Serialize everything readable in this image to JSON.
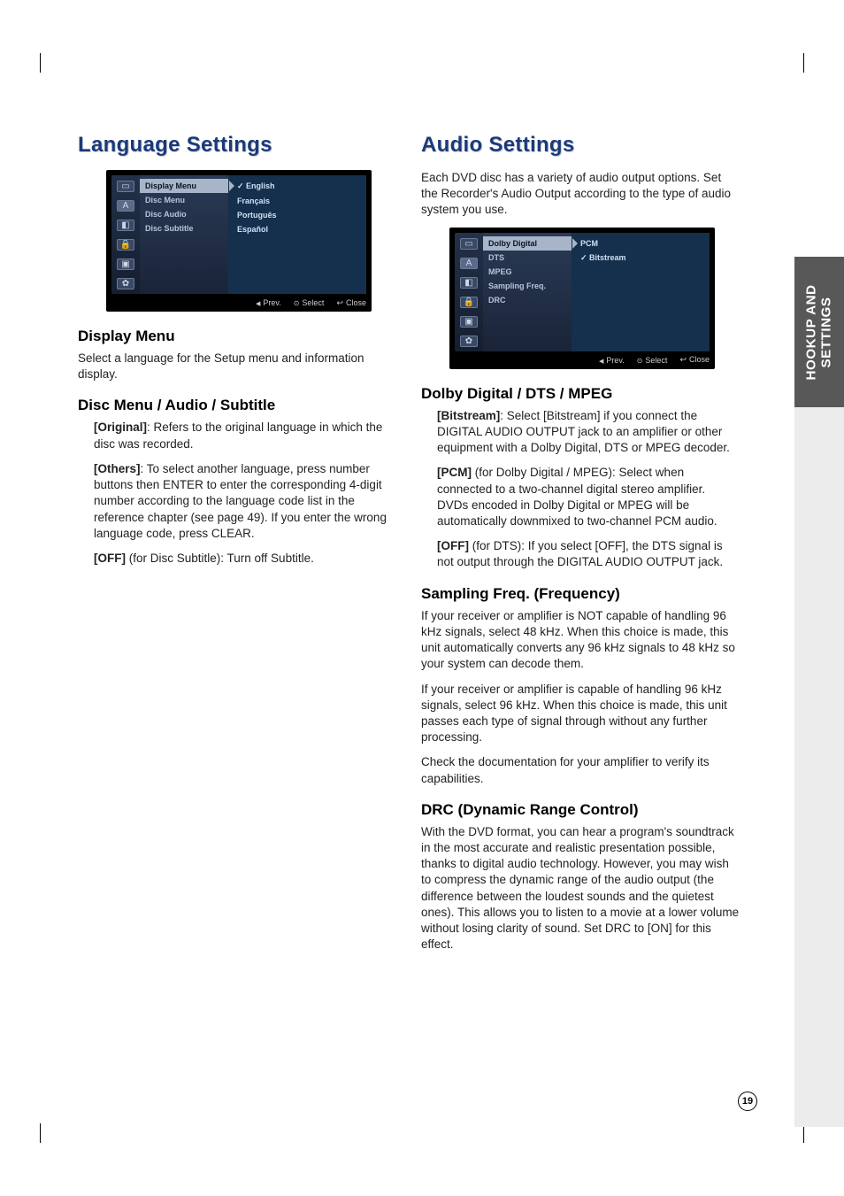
{
  "sidetab": {
    "line1": "HOOKUP AND",
    "line2": "SETTINGS"
  },
  "pagenum": "19",
  "left": {
    "title": "Language Settings",
    "osd": {
      "icons": [
        "▭",
        "A",
        "◧",
        "🔒",
        "▣",
        "✿"
      ],
      "selectedIcon": 1,
      "menu": [
        "Display Menu",
        "Disc Menu",
        "Disc Audio",
        "Disc Subtitle"
      ],
      "selectedMenu": 0,
      "opts": [
        "English",
        "Français",
        "Português",
        "Español"
      ],
      "checkedOpt": 0,
      "footer": {
        "prev": "Prev.",
        "select": "Select",
        "close": "Close"
      }
    },
    "h_display": "Display Menu",
    "p_display": "Select a language for the Setup menu and information display.",
    "h_disc": "Disc Menu / Audio / Subtitle",
    "disc_original_label": "[Original]",
    "disc_original_text": ": Refers to the original language in which the disc was recorded.",
    "disc_others_label": "[Others]",
    "disc_others_text": ": To select another language, press number buttons then ENTER to enter the corresponding 4-digit number according to the language code list in the reference chapter (see page 49). If you enter the wrong language code, press CLEAR.",
    "disc_off_label": "[OFF]",
    "disc_off_text": " (for Disc Subtitle): Turn off Subtitle."
  },
  "right": {
    "title": "Audio Settings",
    "intro": "Each DVD disc has a variety of audio output options. Set the Recorder's Audio Output according to the type of audio system you use.",
    "osd": {
      "icons": [
        "▭",
        "A",
        "◧",
        "🔒",
        "▣",
        "✿"
      ],
      "selectedIcon": 1,
      "menu": [
        "Dolby Digital",
        "DTS",
        "MPEG",
        "Sampling Freq.",
        "DRC"
      ],
      "selectedMenu": 0,
      "opts": [
        "PCM",
        "Bitstream"
      ],
      "checkedOpt": 1,
      "footer": {
        "prev": "Prev.",
        "select": "Select",
        "close": "Close"
      }
    },
    "h_dolby": "Dolby Digital / DTS / MPEG",
    "dolby_bits_label": "[Bitstream]",
    "dolby_bits_text": ": Select [Bitstream] if you connect the DIGITAL AUDIO OUTPUT jack to an amplifier or other equipment with a Dolby Digital, DTS or MPEG decoder.",
    "dolby_pcm_label": "[PCM]",
    "dolby_pcm_text": " (for Dolby Digital / MPEG): Select when connected to a two-channel digital stereo amplifier. DVDs encoded in Dolby Digital or MPEG will be automatically downmixed to two-channel PCM audio.",
    "dolby_off_label": "[OFF]",
    "dolby_off_text": " (for DTS): If you select [OFF], the DTS signal is not output through the DIGITAL AUDIO OUTPUT jack.",
    "h_samp": "Sampling Freq. (Frequency)",
    "samp_p1": "If your receiver or amplifier is NOT capable of handling 96 kHz signals, select 48 kHz. When this choice is made, this unit automatically converts any 96 kHz signals to 48 kHz so your system can decode them.",
    "samp_p2": "If your receiver or amplifier is capable of handling 96 kHz signals, select 96 kHz. When this choice is made, this unit passes each type of signal through without any further processing.",
    "samp_p3": "Check the documentation for your amplifier to verify its capabilities.",
    "h_drc": "DRC (Dynamic Range Control)",
    "drc_p": "With the DVD format, you can hear a program's soundtrack in the most accurate and realistic presentation possible, thanks to digital audio technology. However, you may wish to compress the dynamic range of the audio output (the difference between the loudest sounds and the quietest ones). This allows you to listen to a movie at a lower volume without losing clarity of sound. Set DRC to [ON] for this effect."
  }
}
